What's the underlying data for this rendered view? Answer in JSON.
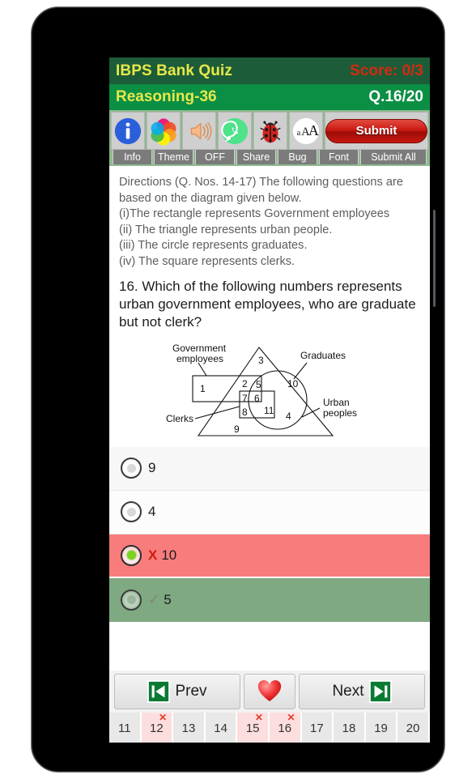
{
  "header": {
    "app_title": "IBPS Bank Quiz",
    "score": "Score: 0/3",
    "topic": "Reasoning-36",
    "question_counter": "Q.16/20",
    "title_bg": "#1d5c38",
    "subbar_bg": "#0a8f44",
    "title_color": "#e8e84a",
    "score_color": "#d42a12"
  },
  "toolbar": {
    "items": [
      {
        "label": "Info",
        "icon": "info-icon"
      },
      {
        "label": "Theme",
        "icon": "theme-palette-icon"
      },
      {
        "label": "OFF",
        "icon": "speaker-icon"
      },
      {
        "label": "Share",
        "icon": "whatsapp-share-icon"
      },
      {
        "label": "Bug",
        "icon": "ladybug-icon"
      },
      {
        "label": "Font",
        "icon": "font-size-icon"
      },
      {
        "label": "Submit All",
        "icon": "submit-button-icon"
      }
    ],
    "submit_label": "Submit",
    "font_icon_text": "aAA"
  },
  "directions": {
    "line1": "Directions (Q. Nos. 14-17) The following questions are",
    "line2": "based on the diagram given below.",
    "line3": "(i)The rectangle represents Government employees",
    "line4": "(ii) The triangle represents urban people.",
    "line5": "(iii) The circle represents graduates.",
    "line6": "(iv) The square represents clerks."
  },
  "question": {
    "text": "16. Which of the following numbers represents urban government employees, who are graduate but not clerk?"
  },
  "diagram": {
    "labels": {
      "government_employees_l1": "Government",
      "government_employees_l2": "employees",
      "graduates": "Graduates",
      "clerks": "Clerks",
      "urban_l1": "Urban",
      "urban_l2": "peoples"
    },
    "regions": {
      "r1": "1",
      "r2": "2",
      "r3": "3",
      "r4": "4",
      "r5": "5",
      "r6": "6",
      "r7": "7",
      "r8": "8",
      "r9": "9",
      "r10": "10",
      "r11": "11"
    }
  },
  "options": [
    {
      "text": "9",
      "state": "plain",
      "mark": ""
    },
    {
      "text": "4",
      "state": "plain",
      "mark": ""
    },
    {
      "text": "10",
      "state": "wrong",
      "mark": "X"
    },
    {
      "text": "5",
      "state": "right",
      "mark": "✓"
    }
  ],
  "nav": {
    "prev_label": "Prev",
    "next_label": "Next",
    "favorite_icon": "heart-icon",
    "prev_icon": "skip-previous-icon",
    "next_icon": "skip-next-icon"
  },
  "question_strip": {
    "cells": [
      {
        "number": "11",
        "wrong": false
      },
      {
        "number": "12",
        "wrong": true
      },
      {
        "number": "13",
        "wrong": false
      },
      {
        "number": "14",
        "wrong": false
      },
      {
        "number": "15",
        "wrong": true
      },
      {
        "number": "16",
        "wrong": true
      },
      {
        "number": "17",
        "wrong": false
      },
      {
        "number": "18",
        "wrong": false
      },
      {
        "number": "19",
        "wrong": false
      },
      {
        "number": "20",
        "wrong": false
      }
    ],
    "x_mark": "✕"
  },
  "android_nav": {
    "back": "back-triangle-icon",
    "home": "home-circle-icon",
    "recents": "recents-square-icon"
  }
}
